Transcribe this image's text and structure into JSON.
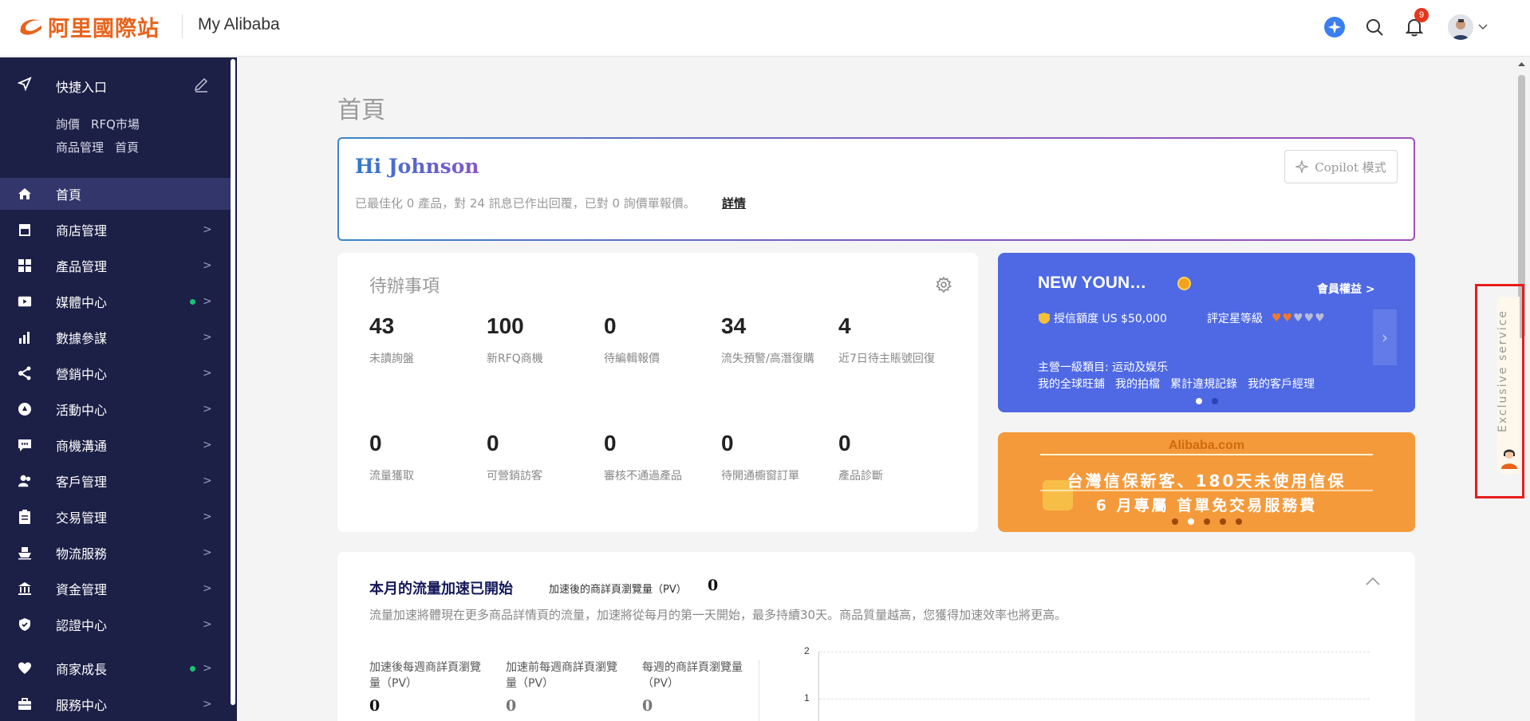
{
  "header": {
    "logo_text": "阿里國際站",
    "app_title": "My Alibaba",
    "notification_count": "9"
  },
  "sidebar": {
    "quick_entry": {
      "title": "快捷入口",
      "links": [
        "詢價",
        "RFQ市場",
        "商品管理",
        "首頁"
      ]
    },
    "items": [
      {
        "label": "首頁",
        "icon": "home-icon",
        "active": true,
        "arrow": "",
        "dot": false
      },
      {
        "label": "商店管理",
        "icon": "store-icon",
        "active": false,
        "arrow": ">",
        "dot": false
      },
      {
        "label": "產品管理",
        "icon": "grid-icon",
        "active": false,
        "arrow": ">",
        "dot": false
      },
      {
        "label": "媒體中心",
        "icon": "video-icon",
        "active": false,
        "arrow": ">",
        "dot": true
      },
      {
        "label": "數據參謀",
        "icon": "bar-chart-icon",
        "active": false,
        "arrow": ">",
        "dot": false
      },
      {
        "label": "營銷中心",
        "icon": "share-icon",
        "active": false,
        "arrow": ">",
        "dot": false
      },
      {
        "label": "活動中心",
        "icon": "activity-icon",
        "active": false,
        "arrow": ">",
        "dot": false
      },
      {
        "label": "商機溝通",
        "icon": "chat-icon",
        "active": false,
        "arrow": ">",
        "dot": false
      },
      {
        "label": "客戶管理",
        "icon": "users-icon",
        "active": false,
        "arrow": ">",
        "dot": false
      },
      {
        "label": "交易管理",
        "icon": "clipboard-icon",
        "active": false,
        "arrow": ">",
        "dot": false
      },
      {
        "label": "物流服務",
        "icon": "ship-icon",
        "active": false,
        "arrow": ">",
        "dot": false
      },
      {
        "label": "資金管理",
        "icon": "bank-icon",
        "active": false,
        "arrow": ">",
        "dot": false
      },
      {
        "label": "認證中心",
        "icon": "shield-icon",
        "active": false,
        "arrow": ">",
        "dot": false
      },
      {
        "label": "商家成長",
        "icon": "heart-icon",
        "active": false,
        "arrow": ">",
        "dot": true
      },
      {
        "label": "服務中心",
        "icon": "briefcase-icon",
        "active": false,
        "arrow": ">",
        "dot": false
      }
    ]
  },
  "main": {
    "page_title": "首頁",
    "greeting": {
      "name": "Hi Johnson",
      "description": "已最佳化 0 產品，對 24 訊息已作出回覆，已對 0 詢價單報價。",
      "detail_link": "詳情",
      "copilot_button": "Copilot 模式"
    },
    "todo": {
      "title": "待辦事項",
      "stats": [
        {
          "value": "43",
          "label": "未讀詢盤"
        },
        {
          "value": "100",
          "label": "新RFQ商機"
        },
        {
          "value": "0",
          "label": "待編輯報價"
        },
        {
          "value": "34",
          "label": "流失預警/高潛復購"
        },
        {
          "value": "4",
          "label": "近7日待主賬號回復"
        },
        {
          "value": "0",
          "label": "流量獲取"
        },
        {
          "value": "0",
          "label": "可營銷訪客"
        },
        {
          "value": "0",
          "label": "審核不通過產品"
        },
        {
          "value": "0",
          "label": "待開通櫥窗訂單"
        },
        {
          "value": "0",
          "label": "產品診斷"
        }
      ]
    },
    "membership": {
      "name": "NEW YOUN…",
      "benefits_link": "會員權益 >",
      "credit": "授信額度 US $50,000",
      "rating_label": "評定星等級",
      "hearts": "♥♥♥♥♥",
      "category": "主營一級類目: 运动及娱乐",
      "links": [
        "我的全球旺鋪",
        "我的拍檔",
        "累計違規記錄",
        "我的客戶經理"
      ],
      "next_arrow": "›"
    },
    "promo_banner": {
      "brand": "Alibaba.com",
      "line1": "台灣信保新客、180天未使用信保",
      "line2": "6 月專屬 首單免交易服務費"
    },
    "traffic": {
      "title": "本月的流量加速已開始",
      "pv_label": "加速後的商詳頁瀏覽量（PV）",
      "pv_value": "0",
      "description": "流量加速將體現在更多商品詳情頁的流量，加速將從每月的第一天開始，最多持續30天。商品質量越高，您獲得加速效率也將更高。",
      "metrics": [
        {
          "label": "加速後每週商詳頁瀏覽量（PV）",
          "value": "0"
        },
        {
          "label": "加速前每週商詳頁瀏覽量（PV）",
          "value": "0"
        },
        {
          "label": "每週的商詳頁瀏覽量（PV）",
          "value": "0"
        }
      ],
      "chart_ticks": [
        "2",
        "1"
      ]
    }
  },
  "exclusive_service": {
    "label": "Exclusive service"
  },
  "colors": {
    "sidebar_bg": "#1c1f46",
    "brand_orange": "#e8631c",
    "member_card": "#4e69e3",
    "banner": "#f59a3a",
    "highlight_box": "#e81c1c"
  }
}
